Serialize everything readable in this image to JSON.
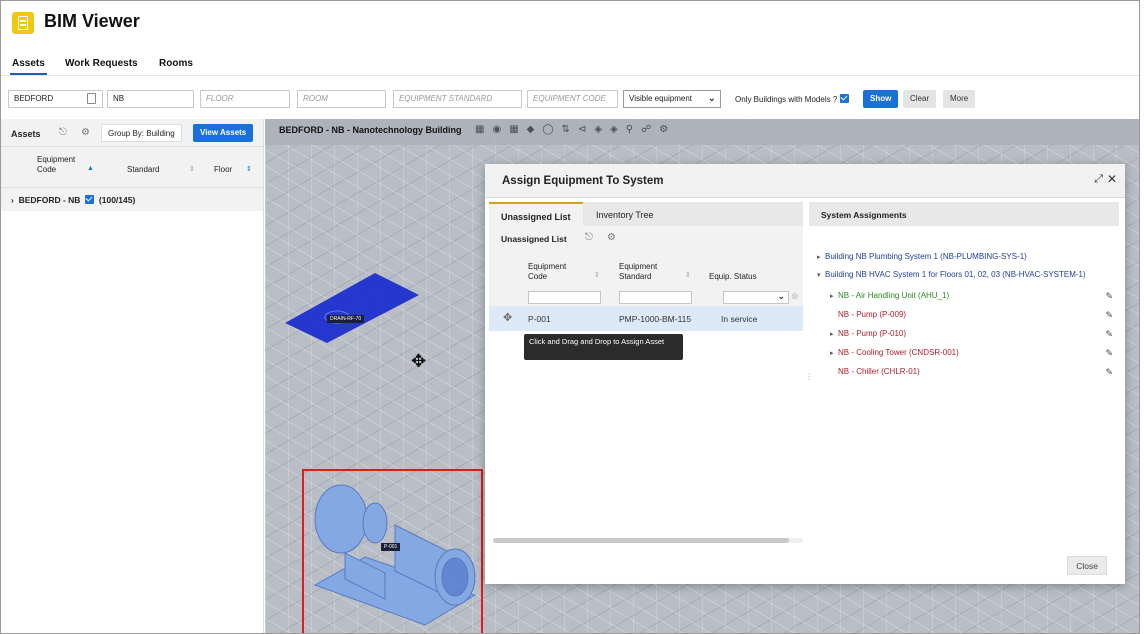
{
  "app": {
    "title": "BIM Viewer"
  },
  "tabs": [
    "Assets",
    "Work Requests",
    "Rooms"
  ],
  "filters": {
    "site": "BEDFORD",
    "building": "NB",
    "floor_placeholder": "FLOOR",
    "room_placeholder": "ROOM",
    "equipment_standard_placeholder": "EQUIPMENT STANDARD",
    "equipment_code_placeholder": "EQUIPMENT CODE",
    "visibility_select": "Visible equipment",
    "only_models_label": "Only Buildings with Models ?",
    "only_models_checked": true,
    "show_label": "Show",
    "clear_label": "Clear",
    "more_label": "More"
  },
  "left_panel": {
    "title": "Assets",
    "group_by": "Group By: Building",
    "view_assets": "View Assets",
    "columns": [
      "Equipment Code",
      "Standard",
      "Floor"
    ],
    "row": {
      "label": "BEDFORD - NB",
      "count": "(100/145)"
    }
  },
  "viewer": {
    "title": "BEDFORD - NB - Nanotechnology Building",
    "drain_label": "DRAIN-RF-70",
    "pump_label": "P-001"
  },
  "dialog": {
    "title": "Assign Equipment To System",
    "tabs": [
      "Unassigned List",
      "Inventory Tree"
    ],
    "list_title": "Unassigned List",
    "columns": [
      "Equipment Code",
      "Equipment Standard",
      "Equip. Status"
    ],
    "rows": [
      {
        "code": "P-001",
        "standard": "PMP-1000-BM-115",
        "status": "In service"
      }
    ],
    "tooltip": "Click and Drag and Drop to Assign Asset",
    "assignments_title": "System Assignments",
    "tree": [
      {
        "label": "Building NB Plumbing System 1 (NB-PLUMBING-SYS-1)",
        "color": "blue",
        "toggle": "▸",
        "level": 0
      },
      {
        "label": "Building NB HVAC System 1 for Floors 01, 02, 03 (NB-HVAC-SYSTEM-1)",
        "color": "blue",
        "toggle": "▾",
        "level": 0
      },
      {
        "label": "NB - Air Handling Unit (AHU_1)",
        "color": "green",
        "toggle": "▸",
        "level": 1
      },
      {
        "label": "NB - Pump (P-009)",
        "color": "red",
        "toggle": "",
        "level": 1
      },
      {
        "label": "NB - Pump (P-010)",
        "color": "red",
        "toggle": "▸",
        "level": 1
      },
      {
        "label": "NB - Cooling Tower (CNDSR-001)",
        "color": "red",
        "toggle": "▸",
        "level": 1
      },
      {
        "label": "NB - Chiller (CHLR-01)",
        "color": "red",
        "toggle": "",
        "level": 1
      }
    ],
    "close_label": "Close"
  },
  "colors": {
    "accent": "#1a6fd9",
    "logo": "#f3c614",
    "highlight_box": "#e01b1b",
    "drain_plane": "#1d2fcf"
  }
}
